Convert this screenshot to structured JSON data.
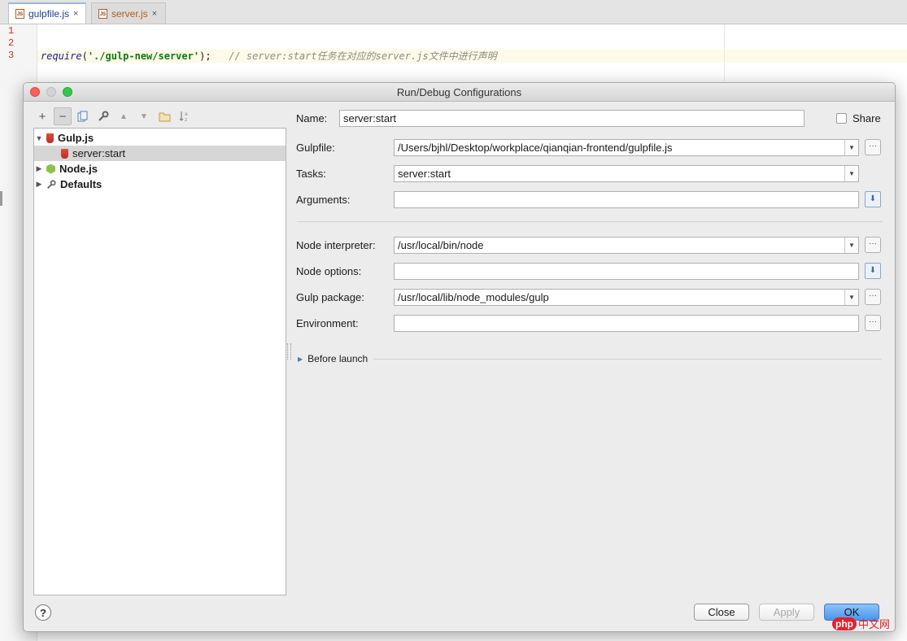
{
  "editor": {
    "tabs": [
      {
        "label": "gulpfile.js",
        "icon": "js-file-icon",
        "close": "×"
      },
      {
        "label": "server.js",
        "icon": "js-file-icon",
        "close": "×"
      }
    ],
    "line_numbers": [
      "1",
      "2",
      "3"
    ],
    "code": {
      "fn": "require",
      "open": "(",
      "string": "'./gulp-new/server'",
      "close": ");",
      "comment": "// server:start任务在对应的server.js文件中进行声明"
    }
  },
  "dialog": {
    "title": "Run/Debug Configurations",
    "toolbar": [
      {
        "name": "add",
        "glyph": "+"
      },
      {
        "name": "remove",
        "glyph": "−"
      },
      {
        "name": "copy",
        "glyph": "⧉"
      },
      {
        "name": "wrench",
        "glyph": "🔧"
      },
      {
        "name": "move-up",
        "glyph": "▲"
      },
      {
        "name": "move-down",
        "glyph": "▼"
      },
      {
        "name": "folder",
        "glyph": "▭"
      },
      {
        "name": "sort",
        "glyph": "↓ᵃᶻ"
      }
    ],
    "tree": [
      {
        "label": "Gulp.js",
        "expanded": true,
        "icon": "gulp-icon"
      },
      {
        "label": "server:start",
        "icon": "gulp-icon",
        "selected": true
      },
      {
        "label": "Node.js",
        "expanded": false,
        "icon": "nodejs-icon"
      },
      {
        "label": "Defaults",
        "expanded": false,
        "icon": "wrench-icon"
      }
    ],
    "form": {
      "name_label": "Name:",
      "name_value": "server:start",
      "share_label": "Share",
      "share_checked": false,
      "gulpfile_label": "Gulpfile:",
      "gulpfile_value": "/Users/bjhl/Desktop/workplace/qianqian-frontend/gulpfile.js",
      "tasks_label": "Tasks:",
      "tasks_value": "server:start",
      "arguments_label": "Arguments:",
      "arguments_value": "",
      "node_interpreter_label": "Node interpreter:",
      "node_interpreter_value": "/usr/local/bin/node",
      "node_options_label": "Node options:",
      "node_options_value": "",
      "gulp_package_label": "Gulp package:",
      "gulp_package_value": "/usr/local/lib/node_modules/gulp",
      "environment_label": "Environment:",
      "environment_value": "",
      "before_launch_label": "Before launch"
    },
    "buttons": {
      "help": "?",
      "close": "Close",
      "apply": "Apply",
      "ok": "OK"
    }
  },
  "watermark": {
    "badge": "php",
    "text": "中文网"
  }
}
